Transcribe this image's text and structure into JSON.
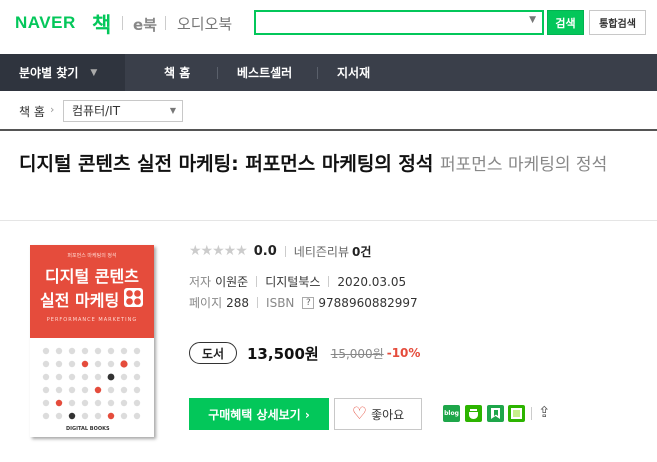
{
  "header": {
    "logo_naver": "NAVER",
    "logo_book": "책",
    "ebook_tab": "e북",
    "audiobook_tab": "오디오북",
    "search_value": "",
    "search_button": "검색",
    "total_search_button": "통합검색"
  },
  "nav": {
    "category": "분야별 찾기",
    "items": [
      "책 홈",
      "베스트셀러",
      "지서재"
    ]
  },
  "breadcrumb": {
    "home": "책 홈",
    "arrow": "›",
    "selected": "컴퓨터/IT"
  },
  "book": {
    "title": "디지털 콘텐츠 실전 마케팅: 퍼포먼스 마케팅의 정석",
    "subtitle": "퍼포먼스 마케팅의 정석",
    "cover": {
      "small_text": "퍼포먼스 마케팅의 정석",
      "title_line1": "디지털 콘텐츠",
      "title_line2": "실전 마케팅",
      "english": "PERFORMANCE MARKETING",
      "publisher_mark": "DIGITAL BOOKS"
    },
    "rating": {
      "stars": "★★★★★",
      "score": "0.0",
      "review_label": "네티즌리뷰",
      "review_count": "0건"
    },
    "meta": {
      "author_label": "저자",
      "author": "이원준",
      "publisher": "디지털북스",
      "date": "2020.03.05",
      "pages_label": "페이지",
      "pages": "288",
      "isbn_label": "ISBN",
      "isbn_help": "?",
      "isbn": "9788960882997"
    },
    "price": {
      "format": "도서",
      "price": "13,500원",
      "original": "15,000원",
      "discount": "-10%"
    },
    "actions": {
      "buy": "구매혜택 상세보기 ›",
      "like_icon": "♡",
      "like": "좋아요",
      "blog": "blog",
      "share_icon": "⇪"
    }
  },
  "colors": {
    "brand_green": "#03c75a",
    "nav_dark": "#3a3f4a",
    "cover_red": "#e54c3c",
    "discount_red": "#e54c3c"
  }
}
